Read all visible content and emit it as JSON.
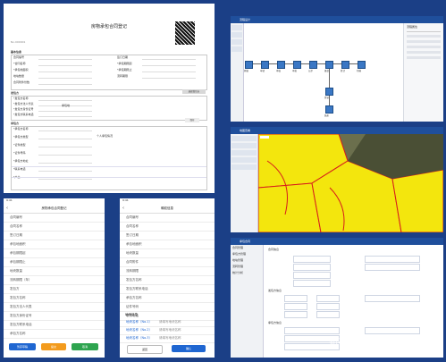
{
  "contract_form": {
    "title": "房物承包合同登记",
    "section_basic": "基本信息",
    "section_party_a": "发包方",
    "section_party_b": "承包方",
    "fields_left": [
      "合同编号",
      "*合同名称",
      "*承包地面积",
      "地块数量",
      "合同附件份数"
    ],
    "fields_right": [
      "签订日期",
      "*承包期限起",
      "*承包期限止",
      "流转期限"
    ],
    "party_a_fields": [
      "*发包方名称",
      "*发包方法人代表",
      "*发包方身份证号",
      "*发包方联系电话"
    ],
    "party_a_values": [
      "承包地"
    ],
    "party_a_button": "选择发包方",
    "party_b_fields": [
      "*承包方名称",
      "*承包方类型",
      "*证件类型",
      "*证件号码",
      "*承包方地址",
      "*联系电话",
      "*户主"
    ],
    "party_b_center_label": "个人承包情况",
    "save_button": "保存"
  },
  "workflow_window": {
    "title": "流程设计",
    "nodes": [
      "开始",
      "申请",
      "审核",
      "审批",
      "公示",
      "备案",
      "签订",
      "归档",
      "登记",
      "结束"
    ],
    "side_panel_title": "流程属性"
  },
  "map_window": {
    "title": "地图查看"
  },
  "mobile_a": {
    "status_time": "9:41",
    "title": "房物承包合同登记",
    "rows": [
      "合同编号",
      "合同名称",
      "签订日期",
      "承包地面积",
      "承包期限起",
      "承包期限止",
      "地块数量",
      "流转期限（年）",
      "发包方",
      "发包方名称",
      "发包方法人代表",
      "发包方身份证号",
      "发包方联系电话",
      "承包方名称"
    ],
    "btn_save": "暂存草稿",
    "btn_submit": "提交",
    "btn_cancel": "取消"
  },
  "mobile_b": {
    "status_time": "9:41",
    "title": "确权信息",
    "rows": [
      "合同编号",
      "合同名称",
      "签订日期",
      "承包地面积",
      "地块数量",
      "合同附件",
      "流转期限",
      "发包方名称",
      "发包方联系电话",
      "承包方名称",
      "证件号码",
      "联系电话"
    ],
    "section": "地块信息",
    "plot_rows": [
      "地块名称（No.1）",
      "地块名称（No.2）",
      "地块名称（No.3）"
    ],
    "plot_values": [
      "请填写地块名称",
      "请填写地块名称",
      "请填写地块名称"
    ],
    "btn_back": "返回",
    "btn_confirm": "确认"
  },
  "detail_window": {
    "title": "承包合同",
    "sidebar": [
      "合同管理",
      "承包方管理",
      "地块管理",
      "流转管理",
      "统计分析"
    ],
    "section_a": "合同信息",
    "section_b": "发包方信息",
    "section_c": "承包方信息"
  },
  "watermark": "知乎 @睿智数码",
  "colors": {
    "background": "#1b3f86",
    "accent": "#1f4f9c",
    "orange": "#f39b1d",
    "green": "#2ea44f"
  }
}
